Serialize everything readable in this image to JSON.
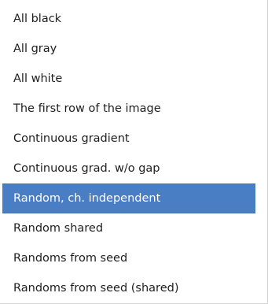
{
  "menu": {
    "items": [
      {
        "label": "All black"
      },
      {
        "label": "All gray"
      },
      {
        "label": "All white"
      },
      {
        "label": "The first row of the image"
      },
      {
        "label": "Continuous gradient"
      },
      {
        "label": "Continuous grad. w/o gap"
      },
      {
        "label": "Random, ch. independent"
      },
      {
        "label": "Random shared"
      },
      {
        "label": "Randoms from seed"
      },
      {
        "label": "Randoms from seed (shared)"
      }
    ],
    "selected_label": "Random, ch. independent"
  }
}
